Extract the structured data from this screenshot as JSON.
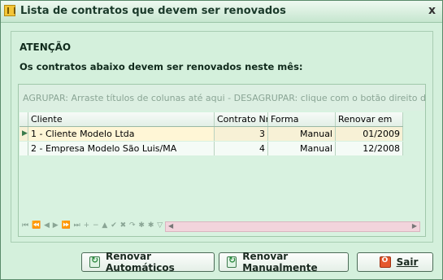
{
  "window": {
    "title": "Lista de contratos que devem ser renovados",
    "close_label": "x"
  },
  "panel": {
    "heading": "ATENÇÃO",
    "message": "Os contratos abaixo devem ser renovados neste mês:"
  },
  "grid": {
    "group_hint": "AGRUPAR: Arraste títulos de colunas até aqui - DESAGRUPAR: clique com o botão direito do mouse a",
    "columns": [
      "Cliente",
      "Contrato Nr.",
      "Forma",
      "Renovar em"
    ],
    "rows": [
      {
        "cliente": "1 - Cliente Modelo Ltda",
        "contrato": "3",
        "forma": "Manual",
        "renovar": "01/2009"
      },
      {
        "cliente": "2 - Empresa Modelo São Luis/MA",
        "contrato": "4",
        "forma": "Manual",
        "renovar": "12/2008"
      }
    ],
    "nav_icons": "⏮ ⏪ ◀ ▶ ⏩ ⏭ + − ▲ ✔ ✖ ↷ ✱ ✱ ▽"
  },
  "buttons": {
    "auto_label": "Renovar Automáticos",
    "manual_label": "Renovar Manualmente",
    "exit_label": "Sair"
  },
  "colors": {
    "background": "#d4f0dc",
    "selected_row": "#fff6d6",
    "exit_icon": "#e5582d"
  }
}
